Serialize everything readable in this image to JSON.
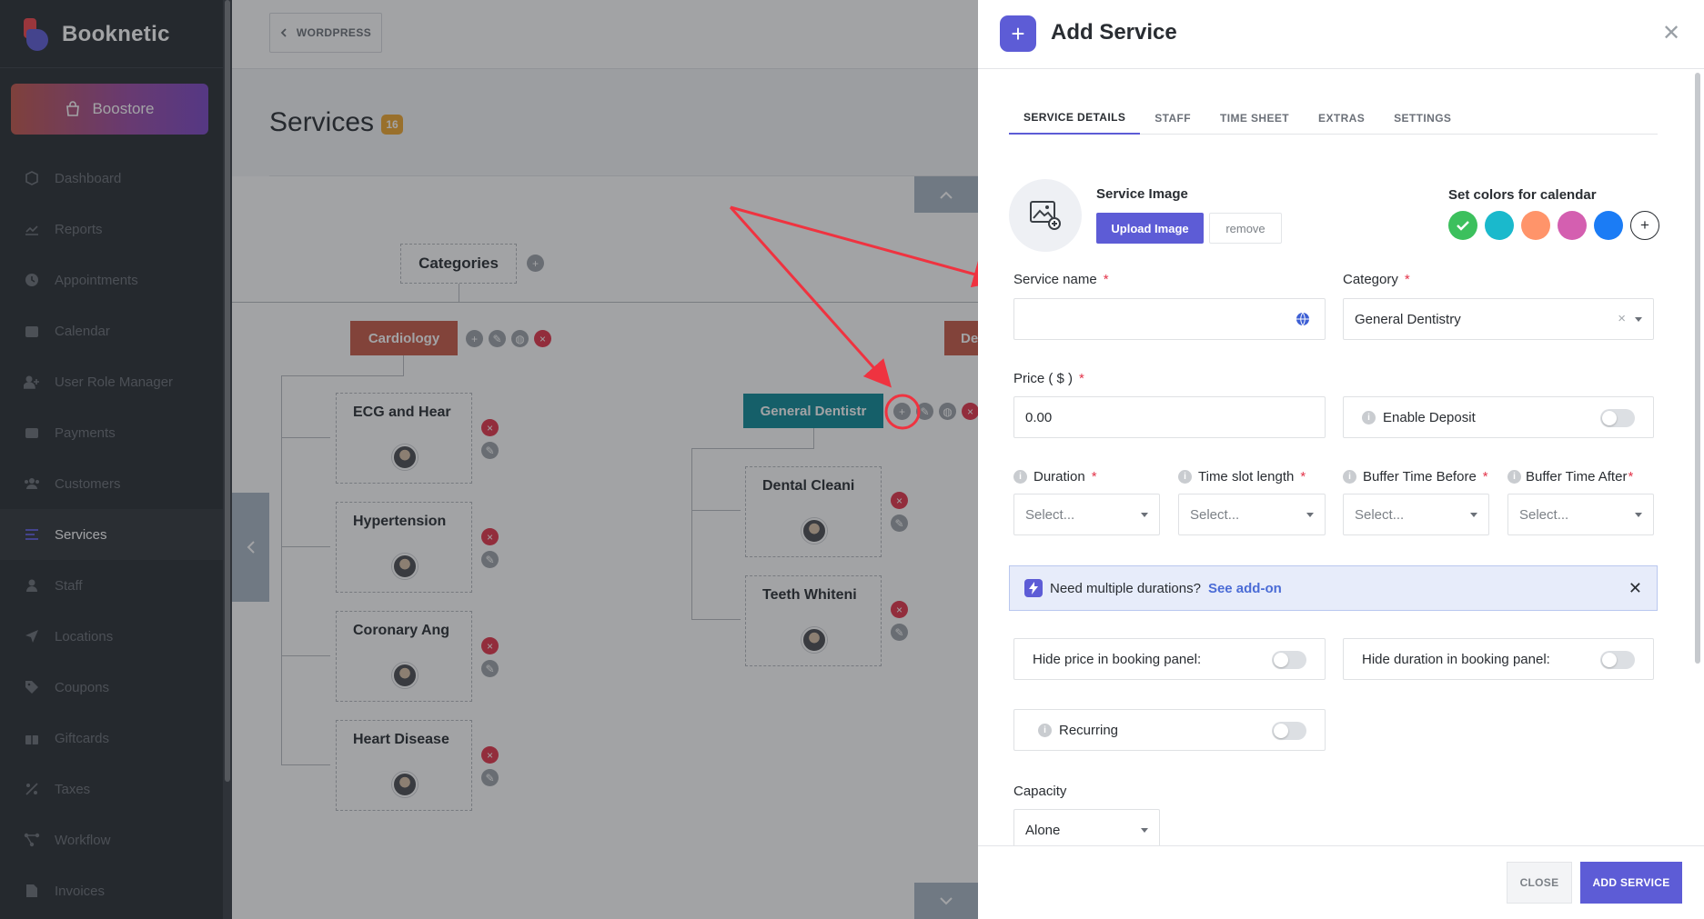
{
  "brand": {
    "name": "Booknetic"
  },
  "sidebar": {
    "boostore_label": "Boostore",
    "items": [
      {
        "label": "Dashboard",
        "icon": "dashboard-icon"
      },
      {
        "label": "Reports",
        "icon": "chart-icon"
      },
      {
        "label": "Appointments",
        "icon": "clock-icon"
      },
      {
        "label": "Calendar",
        "icon": "calendar-icon"
      },
      {
        "label": "User Role Manager",
        "icon": "user-plus-icon"
      },
      {
        "label": "Payments",
        "icon": "wallet-icon"
      },
      {
        "label": "Customers",
        "icon": "users-icon"
      },
      {
        "label": "Services",
        "icon": "list-icon",
        "active": true
      },
      {
        "label": "Staff",
        "icon": "user-icon"
      },
      {
        "label": "Locations",
        "icon": "location-icon"
      },
      {
        "label": "Coupons",
        "icon": "tag-icon"
      },
      {
        "label": "Giftcards",
        "icon": "gift-icon"
      },
      {
        "label": "Taxes",
        "icon": "percent-icon"
      },
      {
        "label": "Workflow",
        "icon": "workflow-icon"
      },
      {
        "label": "Invoices",
        "icon": "invoice-icon"
      }
    ]
  },
  "main": {
    "back_label": "WORDPRESS",
    "page_title": "Services",
    "count": "16",
    "categories_label": "Categories",
    "categories": [
      {
        "name": "Cardiology",
        "color": "#c85a48"
      },
      {
        "name": "General Dentistr",
        "color": "#0d8a98"
      },
      {
        "name": "De",
        "color": "#c85a48"
      }
    ],
    "cardiology_services": [
      "ECG and Hear",
      "Hypertension",
      "Coronary Ang",
      "Heart Disease"
    ],
    "dentistry_services": [
      "Dental Cleani",
      "Teeth Whiteni"
    ]
  },
  "panel": {
    "title": "Add Service",
    "tabs": [
      "SERVICE DETAILS",
      "STAFF",
      "TIME SHEET",
      "EXTRAS",
      "SETTINGS"
    ],
    "active_tab": "SERVICE DETAILS",
    "image": {
      "label": "Service Image",
      "upload_label": "Upload Image",
      "remove_label": "remove"
    },
    "colors": {
      "label": "Set colors for calendar",
      "swatches": [
        "#3cc05d",
        "#1ab9cc",
        "#ff946a",
        "#d45fb0",
        "#1b7cf5"
      ]
    },
    "service_name": {
      "label": "Service name",
      "required": "*",
      "value": ""
    },
    "category": {
      "label": "Category",
      "required": "*",
      "value": "General Dentistry"
    },
    "price": {
      "label": "Price ( $ )",
      "required": "*",
      "value": "0.00"
    },
    "deposit": {
      "label": "Enable Deposit"
    },
    "duration": {
      "label": "Duration",
      "required": "*",
      "value": "Select..."
    },
    "time_slot": {
      "label": "Time slot length",
      "required": "*",
      "value": "Select..."
    },
    "buffer_before": {
      "label": "Buffer Time Before",
      "required": "*",
      "value": "Select..."
    },
    "buffer_after": {
      "label": "Buffer Time After",
      "required": "*",
      "value": "Select..."
    },
    "notice": {
      "text": "Need multiple durations?",
      "link": "See add-on"
    },
    "hide_price": {
      "label": "Hide price in booking panel:"
    },
    "hide_duration": {
      "label": "Hide duration in booking panel:"
    },
    "recurring": {
      "label": "Recurring"
    },
    "capacity": {
      "label": "Capacity",
      "value": "Alone"
    },
    "close_label": "CLOSE",
    "add_label": "ADD SERVICE"
  }
}
